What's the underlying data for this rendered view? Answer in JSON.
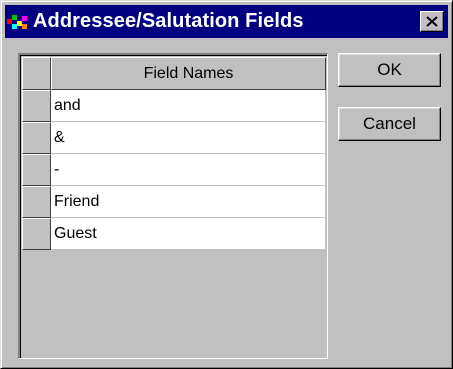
{
  "window": {
    "title": "Addressee/Salutation Fields"
  },
  "grid": {
    "column_header": "Field Names",
    "rows": [
      "and",
      "&",
      "-",
      "Friend",
      "Guest"
    ]
  },
  "buttons": {
    "ok_label": "OK",
    "cancel_label": "Cancel"
  },
  "colors": {
    "titlebar": "#000080",
    "face": "#c0c0c0"
  },
  "icons": {
    "app": "app-icon",
    "close": "close-icon"
  }
}
